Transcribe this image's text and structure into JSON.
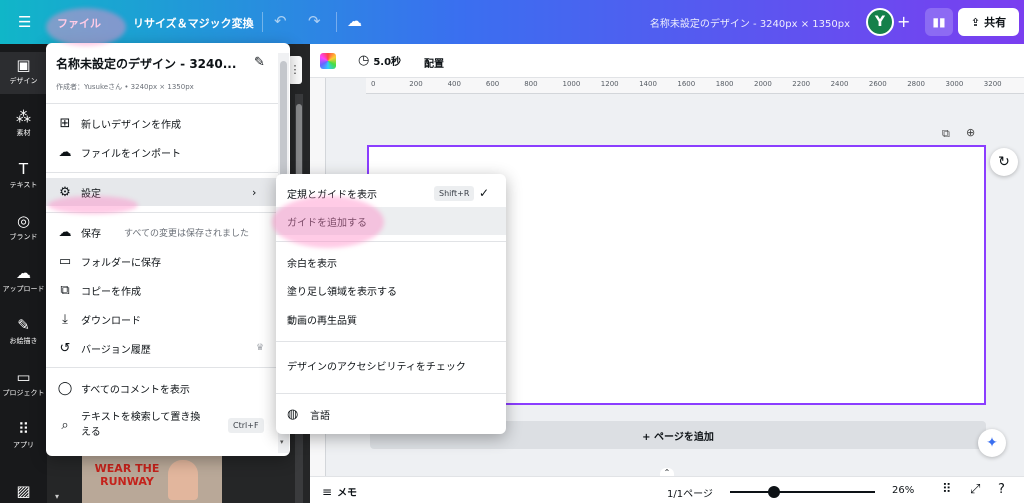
{
  "topbar": {
    "file_label": "ファイル",
    "resize_label": "リサイズ＆マジック変換",
    "doc_title": "名称未設定のデザイン - 3240px × 1350px",
    "avatar_letter": "Y",
    "share_label": "共有",
    "accent_colors": [
      "#10b6c8",
      "#3a6ff0",
      "#7a3ef0"
    ]
  },
  "sidebar": {
    "items": [
      {
        "label": "デザイン",
        "icon": "layout-icon"
      },
      {
        "label": "素材",
        "icon": "elements-icon"
      },
      {
        "label": "テキスト",
        "icon": "text-icon"
      },
      {
        "label": "ブランド",
        "icon": "brand-icon"
      },
      {
        "label": "アップロード",
        "icon": "upload-icon"
      },
      {
        "label": "お絵描き",
        "icon": "draw-icon"
      },
      {
        "label": "プロジェクト",
        "icon": "folder-icon"
      },
      {
        "label": "アプリ",
        "icon": "apps-icon"
      }
    ]
  },
  "panel": {
    "thumb_text": "WEAR THE RUNWAY"
  },
  "file_menu": {
    "title": "名称未設定のデザイン - 3240...",
    "subtitle": "作成者：Yusukeさん • 3240px × 1350px",
    "items": [
      {
        "label": "新しいデザインを作成",
        "icon": "new-design-icon"
      },
      {
        "label": "ファイルをインポート",
        "icon": "cloud-upload-icon"
      },
      {
        "label": "設定",
        "icon": "gear-icon"
      },
      {
        "label": "保存",
        "icon": "cloud-check-icon",
        "note": "すべての変更は保存されました"
      },
      {
        "label": "フォルダーに保存",
        "icon": "folder-icon"
      },
      {
        "label": "コピーを作成",
        "icon": "copy-icon"
      },
      {
        "label": "ダウンロード",
        "icon": "download-icon"
      },
      {
        "label": "バージョン履歴",
        "icon": "history-icon"
      },
      {
        "label": "すべてのコメントを表示",
        "icon": "comment-icon"
      },
      {
        "label": "テキストを検索して置き換える",
        "icon": "search-icon",
        "shortcut": "Ctrl+F"
      }
    ]
  },
  "settings_submenu": {
    "items": [
      {
        "label": "定規とガイドを表示",
        "shortcut": "Shift+R",
        "checked": true
      },
      {
        "label": "ガイドを追加する"
      },
      {
        "label": "余白を表示"
      },
      {
        "label": "塗り足し領域を表示する"
      },
      {
        "label": "動画の再生品質"
      },
      {
        "label": "デザインのアクセシビリティをチェック"
      },
      {
        "label": "言語",
        "icon": "globe-icon"
      }
    ]
  },
  "canvas": {
    "duration": "5.0秒",
    "position_label": "配置",
    "ruler_ticks": [
      "0",
      "200",
      "400",
      "600",
      "800",
      "1000",
      "1200",
      "1400",
      "1600",
      "1800",
      "2000",
      "2200",
      "2400",
      "2600",
      "2800",
      "3000",
      "3200"
    ],
    "add_page_label": "+ ページを追加"
  },
  "bottombar": {
    "notes_label": "メモ",
    "page_indicator": "1/1ページ",
    "zoom": "26%",
    "zoom_level": 0.26
  }
}
